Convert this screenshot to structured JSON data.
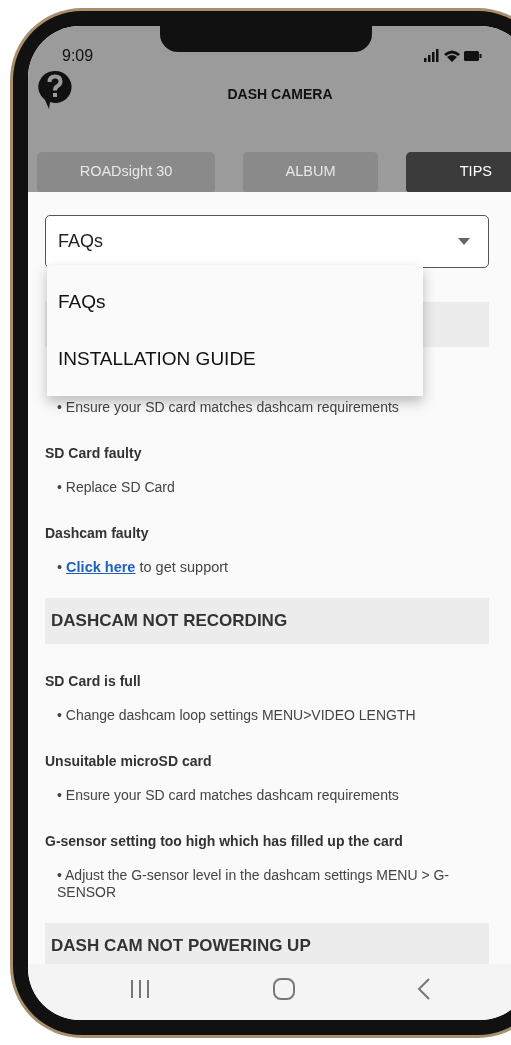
{
  "status_bar": {
    "time": "9:09"
  },
  "header": {
    "title": "DASH CAMERA"
  },
  "tabs": [
    {
      "label": "ROADsight 30",
      "selected": false
    },
    {
      "label": "ALBUM",
      "selected": false
    },
    {
      "label": "TIPS",
      "selected": true
    }
  ],
  "dropdown": {
    "value": "FAQs",
    "expanded": true,
    "options": [
      {
        "label": "FAQs"
      },
      {
        "label": "INSTALLATION GUIDE"
      }
    ]
  },
  "content": [
    {
      "kind": "section"
    },
    {
      "kind": "bullet",
      "text": "• Ensure your SD card matches dashcam requirements"
    },
    {
      "kind": "heading",
      "text": "SD Card faulty"
    },
    {
      "kind": "bullet",
      "text": "• Replace SD Card"
    },
    {
      "kind": "heading",
      "text": "Dashcam faulty"
    },
    {
      "kind": "link_bullet",
      "prefix": "• ",
      "link": "Click here",
      "suffix": " to get support"
    },
    {
      "kind": "section",
      "title": "DASHCAM NOT RECORDING"
    },
    {
      "kind": "heading",
      "text": "SD Card is full"
    },
    {
      "kind": "bullet",
      "text": "• Change dashcam loop settings MENU>VIDEO LENGTH"
    },
    {
      "kind": "heading",
      "text": "Unsuitable microSD card"
    },
    {
      "kind": "bullet",
      "text": "• Ensure your SD card matches dashcam requirements"
    },
    {
      "kind": "heading",
      "text": "G-sensor setting too high which has filled up the card"
    },
    {
      "kind": "bullet",
      "text": "• Adjust the G-sensor level in the dashcam settings MENU > G-SENSOR"
    },
    {
      "kind": "section",
      "title": "DASH CAM NOT POWERING UP"
    }
  ]
}
